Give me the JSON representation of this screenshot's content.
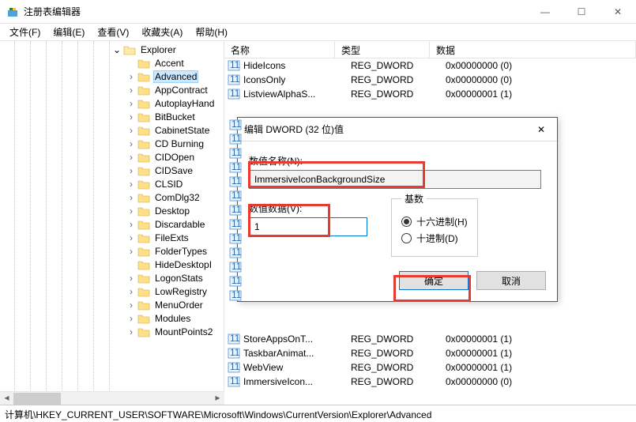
{
  "window": {
    "title": "注册表编辑器"
  },
  "win_controls": {
    "min": "—",
    "max": "☐",
    "close": "✕"
  },
  "menu": {
    "file": "文件(F)",
    "edit": "编辑(E)",
    "view": "查看(V)",
    "fav": "收藏夹(A)",
    "help": "帮助(H)"
  },
  "tree": {
    "root": "Explorer",
    "items": [
      "Accent",
      "Advanced",
      "AppContract",
      "AutoplayHand",
      "BitBucket",
      "CabinetState",
      "CD Burning",
      "CIDOpen",
      "CIDSave",
      "CLSID",
      "ComDlg32",
      "Desktop",
      "Discardable",
      "FileExts",
      "FolderTypes",
      "HideDesktopI",
      "LogonStats",
      "LowRegistry",
      "MenuOrder",
      "Modules",
      "MountPoints2"
    ],
    "selected_index": 1,
    "has_children": {
      "0": false,
      "1": true,
      "2": true,
      "3": true,
      "4": true,
      "5": true,
      "6": true,
      "7": true,
      "8": true,
      "9": true,
      "10": true,
      "11": true,
      "12": true,
      "13": true,
      "14": true,
      "15": false,
      "16": true,
      "17": true,
      "18": true,
      "19": true,
      "20": true
    }
  },
  "list": {
    "headers": {
      "name": "名称",
      "type": "类型",
      "data": "数据"
    },
    "rows": [
      {
        "name": "HideIcons",
        "type": "REG_DWORD",
        "data": "0x00000000 (0)"
      },
      {
        "name": "IconsOnly",
        "type": "REG_DWORD",
        "data": "0x00000000 (0)"
      },
      {
        "name": "ListviewAlphaS...",
        "type": "REG_DWORD",
        "data": "0x00000001 (1)"
      },
      {
        "name": "StoreAppsOnT...",
        "type": "REG_DWORD",
        "data": "0x00000001 (1)"
      },
      {
        "name": "TaskbarAnimat...",
        "type": "REG_DWORD",
        "data": "0x00000001 (1)"
      },
      {
        "name": "WebView",
        "type": "REG_DWORD",
        "data": "0x00000001 (1)"
      },
      {
        "name": "ImmersiveIcon...",
        "type": "REG_DWORD",
        "data": "0x00000000 (0)"
      }
    ]
  },
  "dialog": {
    "title": "编辑 DWORD (32 位)值",
    "name_label": "数值名称(N):",
    "name_value": "ImmersiveIconBackgroundSize",
    "data_label": "数值数据(V):",
    "data_value": "1",
    "base_legend": "基数",
    "radio_hex": "十六进制(H)",
    "radio_dec": "十进制(D)",
    "ok": "确定",
    "cancel": "取消",
    "close_glyph": "✕"
  },
  "statusbar": {
    "path": "计算机\\HKEY_CURRENT_USER\\SOFTWARE\\Microsoft\\Windows\\CurrentVersion\\Explorer\\Advanced"
  }
}
